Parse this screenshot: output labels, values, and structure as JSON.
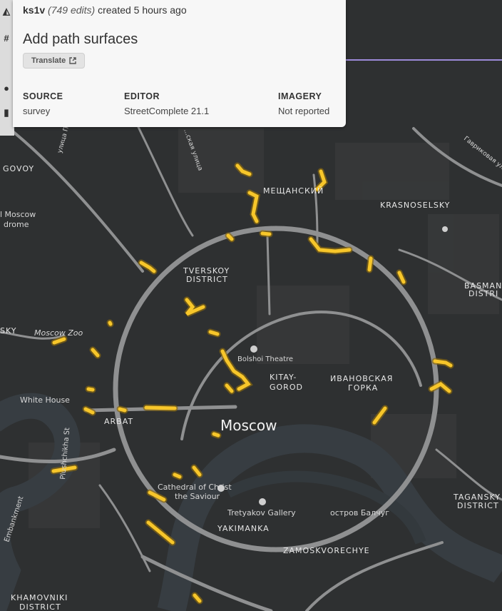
{
  "changeset": {
    "user": "ks1v",
    "edits": "(749 edits)",
    "created": "created 5 hours ago",
    "title": "Add path surfaces",
    "translate_label": "Translate",
    "meta": [
      {
        "heading": "SOURCE",
        "value": "survey"
      },
      {
        "heading": "EDITOR",
        "value": "StreetComplete 21.1"
      },
      {
        "heading": "IMAGERY",
        "value": "Not reported"
      }
    ]
  },
  "sidebar": {
    "icons": [
      "logo-icon",
      "hash-icon",
      "user-icon",
      "layers-icon"
    ],
    "hash_glyph": "#"
  },
  "map": {
    "labels": {
      "meshchansky": "МЕЩАНСКИЙ",
      "krasnoselsky": "KRASNOSELSKY",
      "basmanny_1": "BASMAN",
      "basmanny_2": "DISTRI",
      "tverskoy_1": "TVERSKOY",
      "tverskoy_2": "DISTRICT",
      "moscow_zoo": "Moscow Zoo",
      "presnensky": "SKY",
      "begovoy": "GOVOY",
      "hippodrome_1": "l Moscow",
      "hippodrome_2": "drome",
      "bolshoi": "Bolshoi Theatre",
      "kitay_1": "KITAY-",
      "kitay_2": "GOROD",
      "ivanovskaya_1": "ИВАНОВСКАЯ",
      "ivanovskaya_2": "ГОРКА",
      "white_house": "White House",
      "arbat": "ARBAT",
      "moscow": "Moscow",
      "cathedral_1": "Cathedral of Christ",
      "cathedral_2": "the Saviour",
      "tretyakov": "Tretyakov Gallery",
      "balchug": "остров Балчуг",
      "yakimanka": "YAKIMANKA",
      "zamoskvorechye": "ZAMOSKVORECHYE",
      "taganskiy_1": "TAGANSKY",
      "taganskiy_2": "DISTRICT",
      "khamovniki_1": "KHAMOVNIKI",
      "khamovniki_2": "DISTRICT",
      "plyushchikha": "Plushchikha St",
      "embankment": "Embankment",
      "ulitsa_pravdy": "улица Правды",
      "sadovaya": "...ская улица",
      "gavrikova": "Гавриковая улица"
    },
    "colors": {
      "edit": "#f7c62a",
      "road": "#8f9091",
      "river": "#343b40",
      "land": "#2e3031"
    }
  }
}
